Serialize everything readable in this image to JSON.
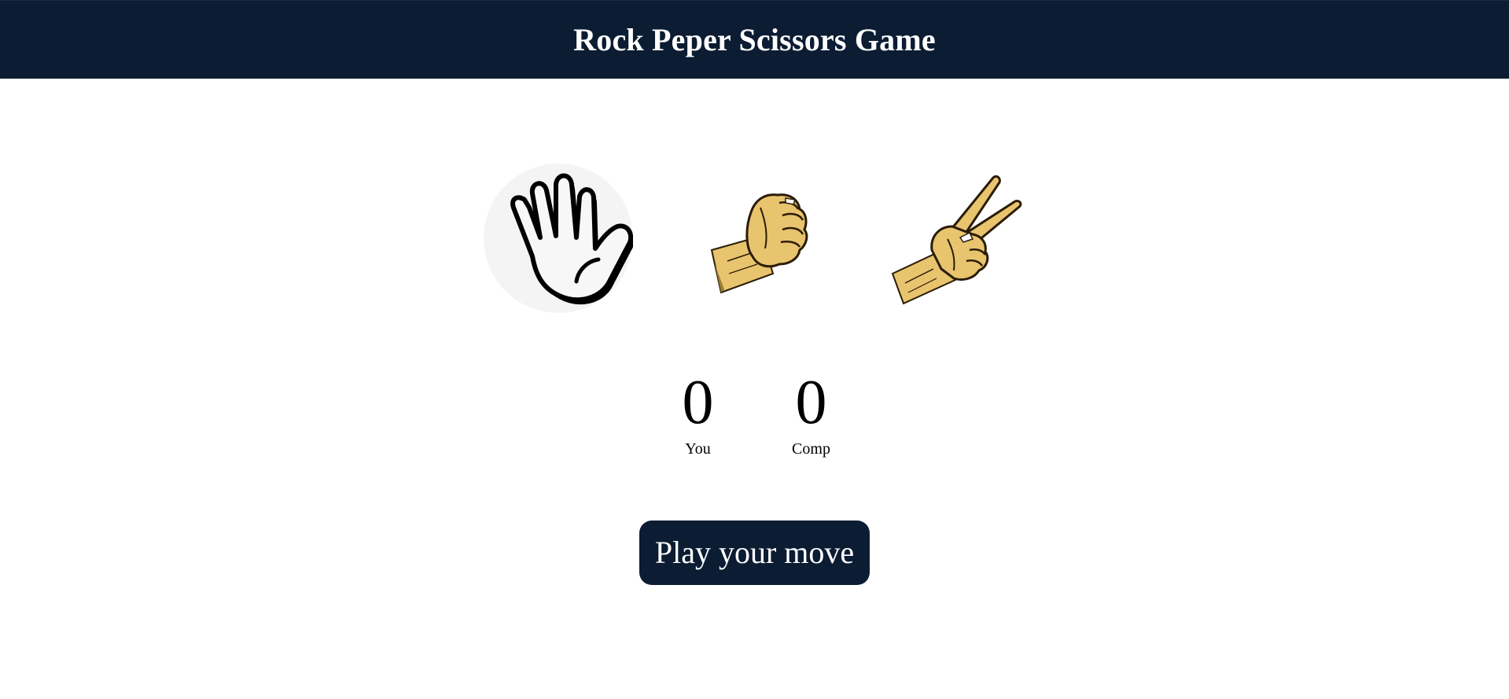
{
  "header": {
    "title": "Rock Peper Scissors Game"
  },
  "choices": [
    {
      "id": "paper",
      "icon": "open-hand-paper-icon"
    },
    {
      "id": "rock",
      "icon": "fist-rock-icon"
    },
    {
      "id": "scissors",
      "icon": "peace-sign-scissors-icon"
    }
  ],
  "scores": {
    "user": {
      "value": "0",
      "label": "You"
    },
    "comp": {
      "value": "0",
      "label": "Comp"
    }
  },
  "message": {
    "text": "Play your move"
  },
  "colors": {
    "header_bg": "#0b1c33",
    "button_bg": "#0b1c33",
    "hand_skin": "#e8c46e",
    "hover_circle": "#f4f4f4"
  }
}
